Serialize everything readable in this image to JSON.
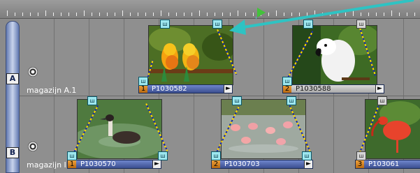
{
  "lanes": [
    {
      "letter": "A",
      "label": "magazijn A.1"
    },
    {
      "letter": "B",
      "label": "magazijn I.1"
    }
  ],
  "clips_a": [
    {
      "num": "1",
      "name": "P1030582",
      "image": "parakeets"
    },
    {
      "num": "2",
      "name": "P1030588",
      "image": "cockatoo"
    }
  ],
  "clips_b": [
    {
      "num": "1",
      "name": "P1030570",
      "image": "grebe"
    },
    {
      "num": "2",
      "name": "P1030703",
      "image": "flamingos"
    },
    {
      "num": "3",
      "name": "P103061",
      "image": "ibis"
    }
  ],
  "handle_icon": "fade-handle-icon",
  "colors": {
    "accent_arrow": "#2ec3c3",
    "playhead": "#43c23b",
    "clip_bar_blue": "#4a60a8",
    "clip_number": "#e58b1f",
    "fade_line": "#ffd400"
  }
}
